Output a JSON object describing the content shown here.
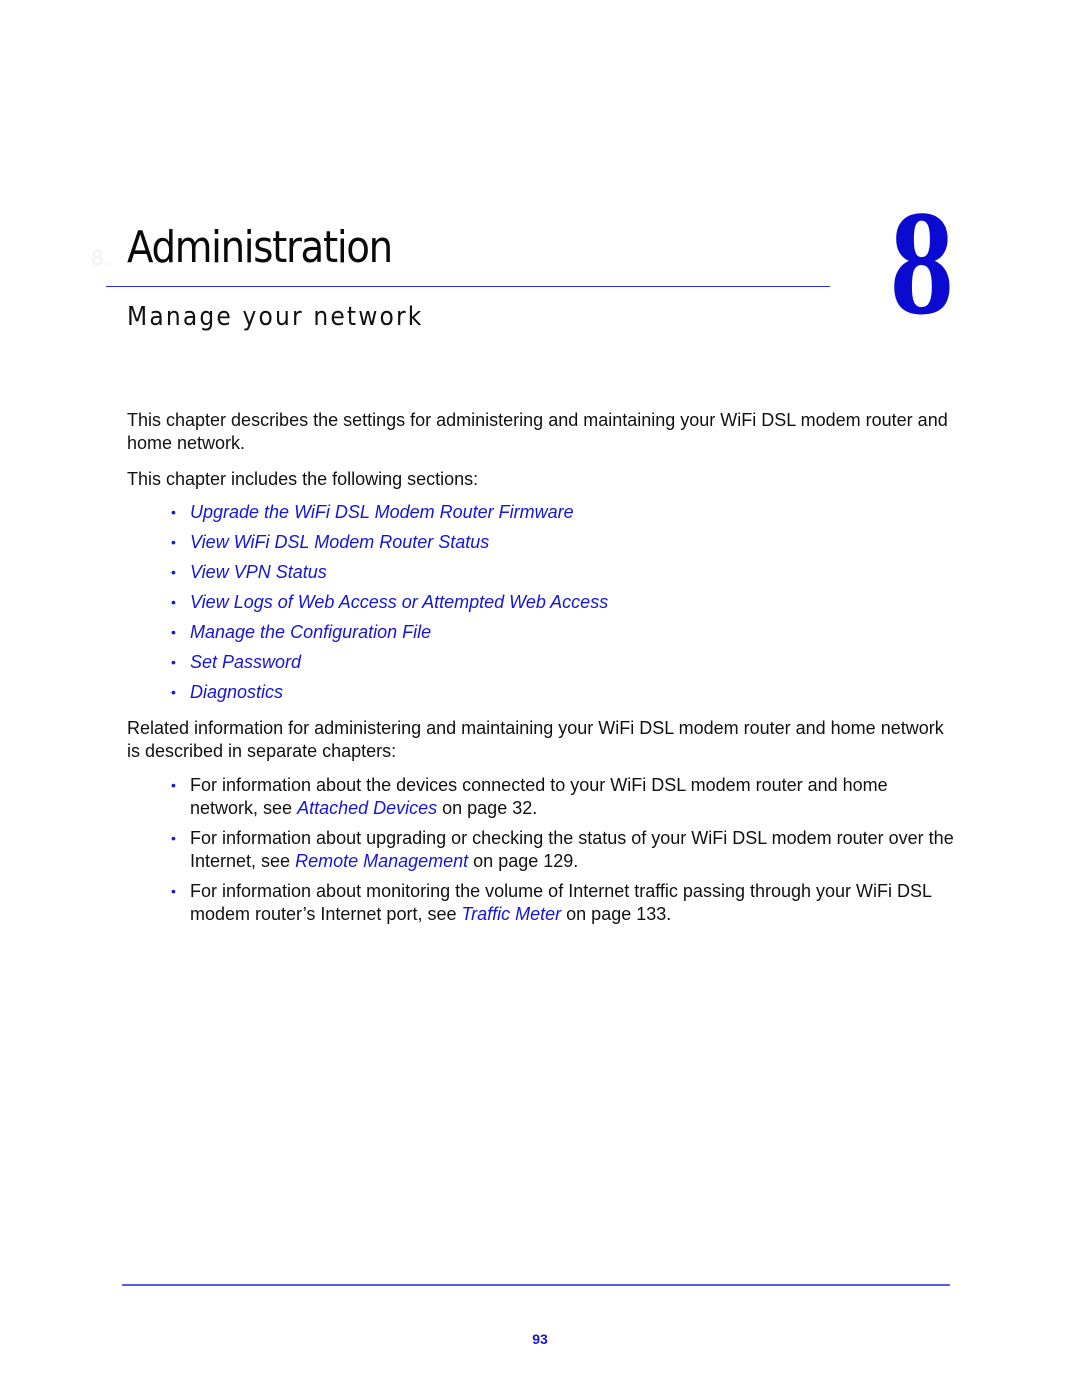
{
  "header": {
    "ghost_label": "8.",
    "title": "Administration",
    "chapter_number": "8",
    "subtitle": "Manage your network"
  },
  "intro": {
    "paragraph": "This chapter describes the settings for administering and maintaining your WiFi DSL modem router and home network.",
    "sections_intro": "This chapter includes the following sections:"
  },
  "sections": [
    "Upgrade the WiFi DSL Modem Router Firmware",
    "View WiFi DSL Modem Router Status",
    "View VPN Status",
    "View Logs of Web Access or Attempted Web Access",
    "Manage the Configuration File",
    "Set Password",
    "Diagnostics"
  ],
  "related": {
    "intro": "Related information for administering and maintaining your WiFi DSL modem router and home network is described in separate chapters:",
    "items": [
      {
        "before": "For information about the devices connected to your WiFi DSL modem router and home network, see ",
        "link": "Attached Devices",
        "after": " on page 32."
      },
      {
        "before": "For information about upgrading or checking the status of your WiFi DSL modem router over the Internet, see ",
        "link": "Remote Management",
        "after": " on page 129."
      },
      {
        "before": "For information about monitoring the volume of Internet traffic passing through your WiFi DSL modem router’s Internet port, see ",
        "link": "Traffic Meter",
        "after": " on page 133."
      }
    ]
  },
  "bullet_glyph": "•",
  "footer": {
    "page_number": "93"
  },
  "colors": {
    "link": "#1515d6",
    "rule": "#2a2ad8",
    "chapter_number": "#0a0ad0"
  }
}
